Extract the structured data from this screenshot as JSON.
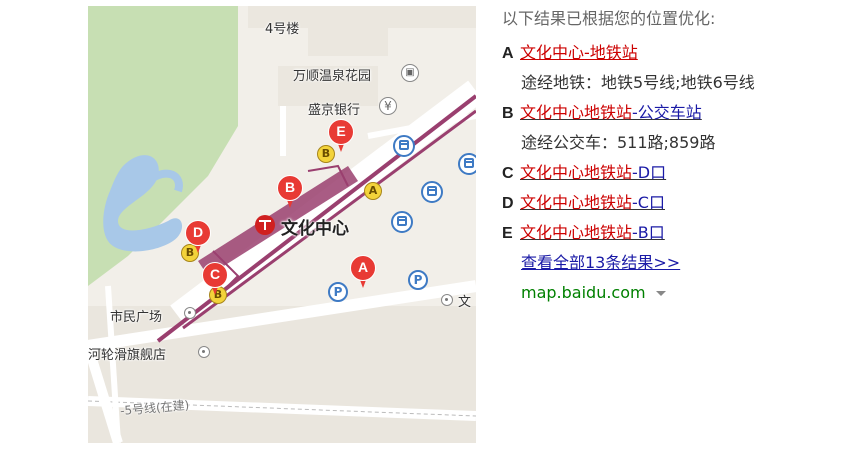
{
  "map": {
    "labels": {
      "building4": "4号楼",
      "hotspring": "万顺温泉花园",
      "bank": "盛京银行",
      "bank_symbol": "¥",
      "station": "文化中心",
      "plaza": "市民广场",
      "flagship": "河轮滑旗舰店",
      "metro_line": "-5号线(在建)",
      "edge_text": "文"
    },
    "pins": [
      {
        "letter": "E"
      },
      {
        "letter": "B"
      },
      {
        "letter": "D"
      },
      {
        "letter": "C"
      },
      {
        "letter": "A"
      }
    ],
    "exits": [
      "B",
      "A",
      "B",
      "B"
    ],
    "parking_symbol": "P",
    "icons": {
      "bus": "bus-icon",
      "parking": "parking-icon",
      "metro": "metro-icon",
      "poi": "poi-dot-icon"
    },
    "colors": {
      "pin": "#e83a34",
      "metro_line": "#9a3f6f",
      "park": "#c7dfb3",
      "water": "#a8c8e8",
      "road": "#ffffff",
      "ground": "#f2efe9"
    }
  },
  "results": {
    "header": "以下结果已根据您的位置优化:",
    "items": [
      {
        "letter": "A",
        "prefix": "文化中心",
        "suffix": "-地铁站",
        "detail": "途经地铁：地铁5号线;地铁6号线"
      },
      {
        "letter": "B",
        "prefix": "文化中心地铁站",
        "suffix": "-公交车站",
        "detail": "途经公交车：511路;859路"
      },
      {
        "letter": "C",
        "prefix": "文化中心地铁站",
        "suffix": "-D口"
      },
      {
        "letter": "D",
        "prefix": "文化中心地铁站",
        "suffix": "-C口"
      },
      {
        "letter": "E",
        "prefix": "文化中心地铁站",
        "suffix": "-B口"
      }
    ],
    "view_all": "查看全部13条结果>>",
    "source": "map.baidu.com",
    "colors": {
      "link_primary": "#c00",
      "link_secondary": "#1a1aa6",
      "source": "#008000"
    }
  }
}
